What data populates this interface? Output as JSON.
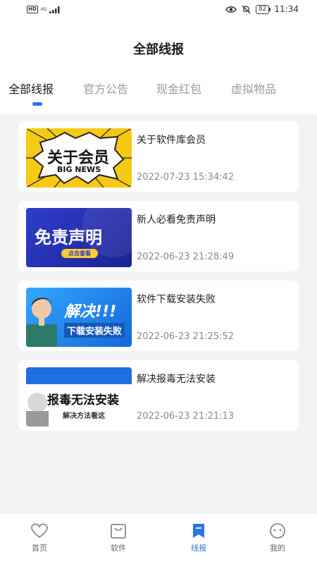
{
  "status_bar": {
    "hd": "HD",
    "signal": "4G",
    "battery": "82",
    "time": "11:34"
  },
  "header": {
    "title": "全部线报"
  },
  "tabs": [
    {
      "label": "全部线报",
      "active": true
    },
    {
      "label": "官方公告",
      "active": false
    },
    {
      "label": "现金红包",
      "active": false
    },
    {
      "label": "虚拟物品",
      "active": false
    }
  ],
  "posts": [
    {
      "title": "关于软件库会员",
      "time": "2022-07-23 15:34:42",
      "thumb_text_main": "关于会员",
      "thumb_text_sub": "BIG NEWS"
    },
    {
      "title": "新人必看免责声明",
      "time": "2022-06-23 21:28:49",
      "thumb_text_main": "免责声明",
      "thumb_text_sub": "点击查看"
    },
    {
      "title": "软件下载安装失败",
      "time": "2022-06-23 21:25:52",
      "thumb_text_main": "解决!!!",
      "thumb_text_sub": "下载安装失败"
    },
    {
      "title": "解决报毒无法安装",
      "time": "2022-06-23 21:21:13",
      "thumb_text_main": "报毒无法安装",
      "thumb_text_sub": "解决方法看这"
    }
  ],
  "bottom_nav": [
    {
      "label": "首页",
      "icon": "heart-icon",
      "active": false
    },
    {
      "label": "软件",
      "icon": "bag-icon",
      "active": false
    },
    {
      "label": "线报",
      "icon": "bookmark-icon",
      "active": true
    },
    {
      "label": "我的",
      "icon": "smiley-icon",
      "active": false
    }
  ],
  "colors": {
    "accent": "#2a73e8",
    "background": "#f3f3f5"
  }
}
